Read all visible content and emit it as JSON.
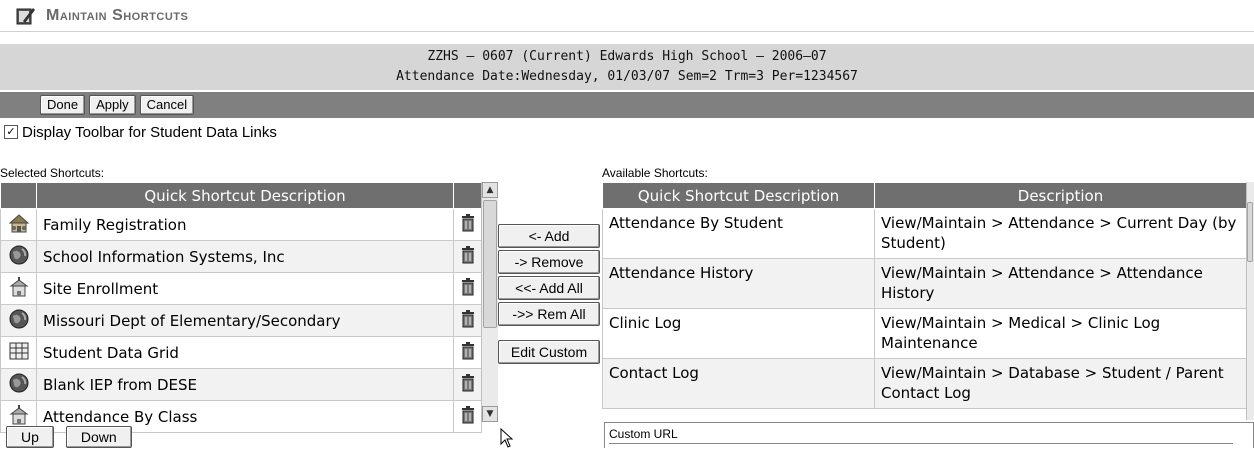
{
  "title": "Maintain Shortcuts",
  "info": {
    "line1": "ZZHS – 0607 (Current) Edwards High School – 2006–07",
    "line2": "Attendance Date:Wednesday, 01/03/07 Sem=2 Trm=3 Per=1234567"
  },
  "toolbar": {
    "done": "Done",
    "apply": "Apply",
    "cancel": "Cancel"
  },
  "toolbar_checkbox": {
    "label": "Display Toolbar for Student Data Links",
    "checked": true
  },
  "selected": {
    "label": "Selected Shortcuts:",
    "header": "Quick Shortcut Description",
    "rows": [
      {
        "icon": "house-icon",
        "text": "Family Registration"
      },
      {
        "icon": "globe-icon",
        "text": "School Information Systems, Inc"
      },
      {
        "icon": "school-icon",
        "text": "Site Enrollment"
      },
      {
        "icon": "globe-icon",
        "text": "Missouri Dept of Elementary/Secondary"
      },
      {
        "icon": "grid-icon",
        "text": "Student Data Grid"
      },
      {
        "icon": "globe-icon",
        "text": "Blank IEP from DESE"
      },
      {
        "icon": "school-icon",
        "text": "Attendance By Class"
      }
    ]
  },
  "mid_buttons": {
    "add": "<- Add",
    "remove": "-> Remove",
    "add_all": "<<- Add All",
    "rem_all": "->> Rem All",
    "edit_custom": "Edit Custom"
  },
  "available": {
    "label": "Available Shortcuts:",
    "headers": [
      "Quick Shortcut Description",
      "Description"
    ],
    "rows": [
      {
        "name": "Attendance By Student",
        "desc": "View/Maintain > Attendance > Current Day (by Student)"
      },
      {
        "name": "Attendance History",
        "desc": "View/Maintain > Attendance > Attendance History"
      },
      {
        "name": "Clinic Log",
        "desc": "View/Maintain > Medical > Clinic Log Maintenance"
      },
      {
        "name": "Contact Log",
        "desc": "View/Maintain > Database > Student / Parent Contact Log"
      }
    ]
  },
  "custom_url": {
    "label": "Custom URL"
  },
  "order_buttons": {
    "up": "Up",
    "down": "Down"
  }
}
